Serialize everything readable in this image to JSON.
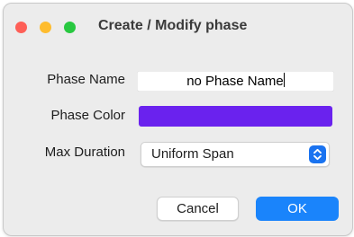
{
  "window": {
    "title": "Create / Modify phase",
    "traffic_lights": {
      "close_color": "#fe5f57",
      "minimize_color": "#febc2e",
      "zoom_color": "#28c840"
    }
  },
  "form": {
    "phase_name": {
      "label": "Phase Name",
      "value": "no Phase Name"
    },
    "phase_color": {
      "label": "Phase Color",
      "value": "#6a22ee"
    },
    "max_duration": {
      "label": "Max Duration",
      "selected": "Uniform Span",
      "stepper_color": "#1a73f0",
      "icon": "up-down-chevron-icon"
    }
  },
  "buttons": {
    "cancel_label": "Cancel",
    "ok_label": "OK",
    "ok_color": "#1a84fb"
  }
}
